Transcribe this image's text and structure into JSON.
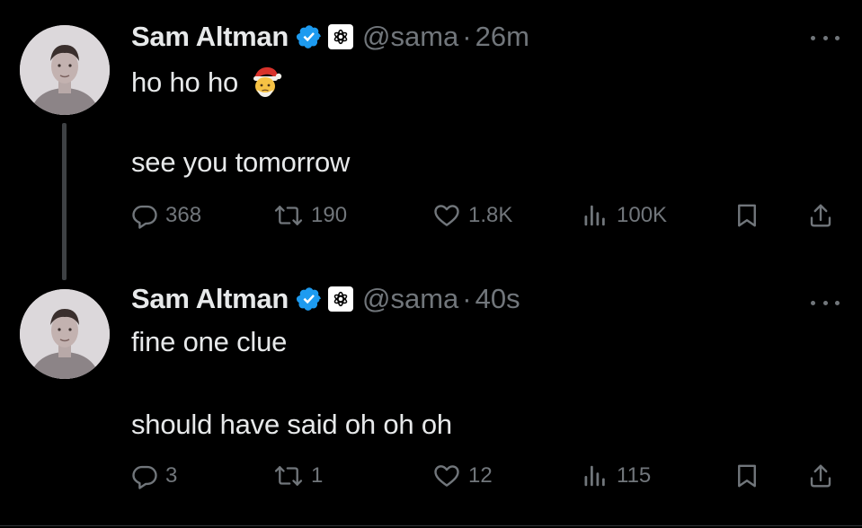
{
  "tweets": [
    {
      "author_name": "Sam Altman",
      "handle": "@sama",
      "separator": "·",
      "time": "26m",
      "text_line1": "ho ho ho",
      "emoji": "santa-face-emoji",
      "text_line2": "see you tomorrow",
      "stats": {
        "replies": "368",
        "reposts": "190",
        "likes": "1.8K",
        "views": "100K"
      }
    },
    {
      "author_name": "Sam Altman",
      "handle": "@sama",
      "separator": "·",
      "time": "40s",
      "text_line1": "fine one clue",
      "text_line2": "should have said oh oh oh",
      "stats": {
        "replies": "3",
        "reposts": "1",
        "likes": "12",
        "views": "115"
      }
    }
  ],
  "icons": {
    "reply": "reply-icon",
    "repost": "repost-icon",
    "like": "heart-icon",
    "views": "views-chart-icon",
    "bookmark": "bookmark-icon",
    "share": "share-icon",
    "verified": "verified-badge-icon",
    "org": "openai-logo-icon",
    "more": "more-options-icon"
  },
  "colors": {
    "background": "#000000",
    "text": "#e7e9ea",
    "muted": "#71767b",
    "verified_blue": "#1d9bf0",
    "thread_line": "#3e4144"
  }
}
